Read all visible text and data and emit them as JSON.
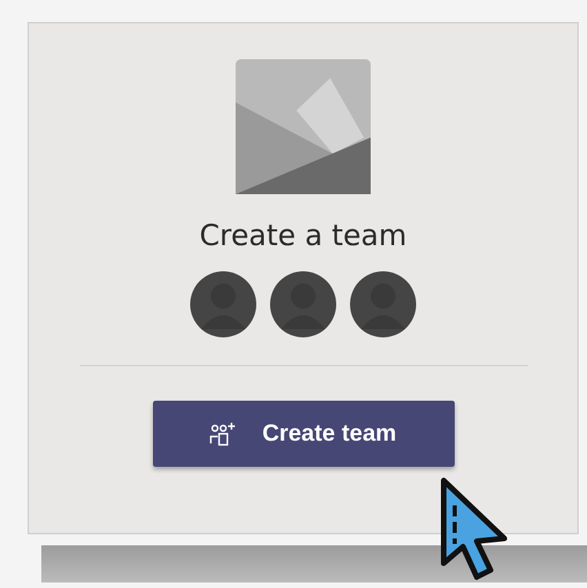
{
  "card": {
    "title": "Create a team",
    "button": {
      "label": "Create team"
    }
  }
}
